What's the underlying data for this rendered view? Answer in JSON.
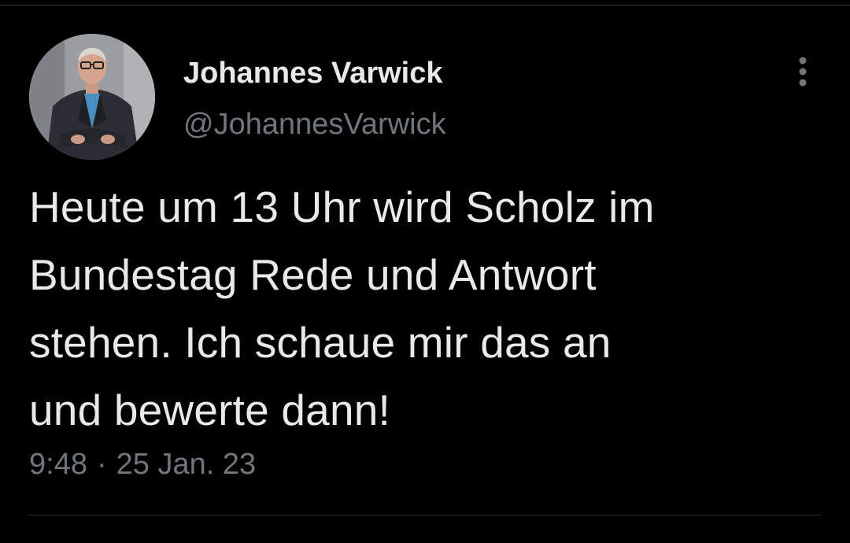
{
  "tweet": {
    "author": {
      "display_name": "Johannes Varwick",
      "handle": "@JohannesVarwick",
      "avatar_icon": "profile-photo"
    },
    "more_icon": "more-vertical-icon",
    "text_lines": [
      "Heute um 13 Uhr wird Scholz im",
      "Bundestag Rede und Antwort",
      "stehen. Ich schaue mir das an",
      "und bewerte dann!"
    ],
    "time": "9:48",
    "separator": "·",
    "date": "25 Jan. 23"
  },
  "colors": {
    "background": "#000000",
    "text_primary": "#e7e9ea",
    "text_secondary": "#71767b",
    "divider": "#2f3336"
  }
}
